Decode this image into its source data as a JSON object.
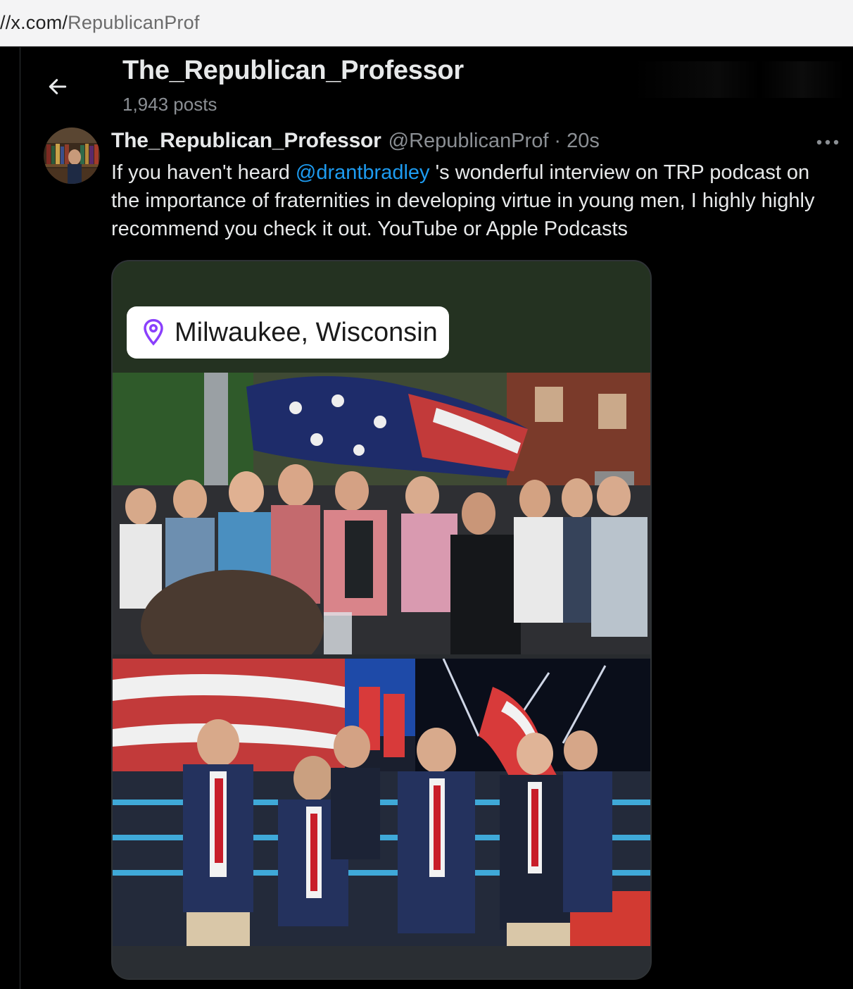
{
  "browser": {
    "url_prefix": "//x.com/",
    "url_path": "RepublicanProf"
  },
  "header": {
    "back_icon": "arrow-left-icon",
    "title": "The_Republican_Professor",
    "post_count": "1,943 posts"
  },
  "tweet": {
    "display_name": "The_Republican_Professor",
    "handle": "@RepublicanProf",
    "separator": "·",
    "timestamp": "20s",
    "more_icon": "more-horizontal-icon",
    "text_before": "If you haven't heard ",
    "mention": "@drantbradley",
    "text_after": " 's wonderful interview on TRP podcast on the importance of fraternities in developing virtue in young men, I highly highly recommend you check it out. YouTube or Apple Podcasts"
  },
  "media": {
    "location_icon": "map-pin-icon",
    "location_label": "Milwaukee, Wisconsin"
  },
  "colors": {
    "background": "#000000",
    "text_primary": "#e7e9ea",
    "text_secondary": "#8b8f94",
    "link": "#1d9bf0",
    "pin": "#8a3ffc",
    "media_band": "#243221"
  }
}
